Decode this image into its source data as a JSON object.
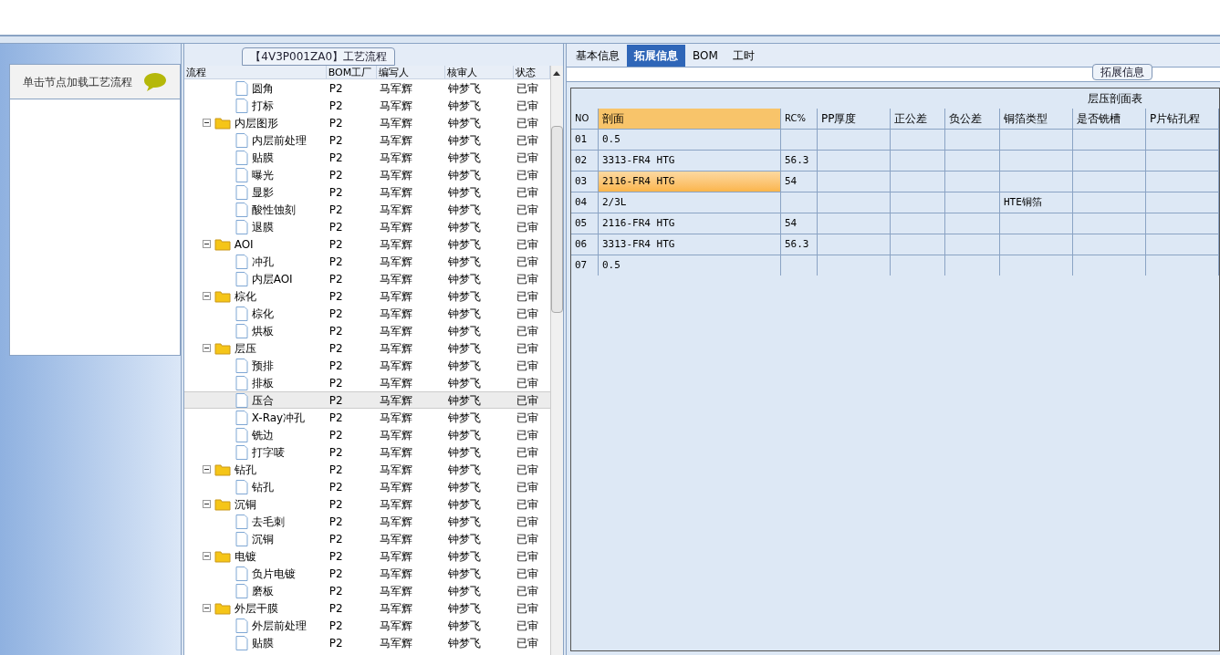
{
  "left_panel": {
    "hint": "单击节点加载工艺流程"
  },
  "flow_panel": {
    "title": "【4V3P001ZA0】工艺流程",
    "columns": [
      "流程",
      "BOM工厂",
      "编写人",
      "核审人",
      "状态"
    ],
    "tree": [
      {
        "kind": "file",
        "label": "圆角",
        "selected": false,
        "cells": [
          "P2",
          "马军辉",
          "钟梦飞",
          "已审"
        ]
      },
      {
        "kind": "file",
        "label": "打标",
        "selected": false,
        "cells": [
          "P2",
          "马军辉",
          "钟梦飞",
          "已审"
        ]
      },
      {
        "kind": "folder",
        "label": "内层图形",
        "expanded": true,
        "selected": false,
        "cells": [
          "P2",
          "马军辉",
          "钟梦飞",
          "已审"
        ],
        "children": [
          {
            "kind": "file",
            "label": "内层前处理",
            "selected": false,
            "cells": [
              "P2",
              "马军辉",
              "钟梦飞",
              "已审"
            ]
          },
          {
            "kind": "file",
            "label": "贴膜",
            "selected": false,
            "cells": [
              "P2",
              "马军辉",
              "钟梦飞",
              "已审"
            ]
          },
          {
            "kind": "file",
            "label": "曝光",
            "selected": false,
            "cells": [
              "P2",
              "马军辉",
              "钟梦飞",
              "已审"
            ]
          },
          {
            "kind": "file",
            "label": "显影",
            "selected": false,
            "cells": [
              "P2",
              "马军辉",
              "钟梦飞",
              "已审"
            ]
          },
          {
            "kind": "file",
            "label": "酸性蚀刻",
            "selected": false,
            "cells": [
              "P2",
              "马军辉",
              "钟梦飞",
              "已审"
            ]
          },
          {
            "kind": "file",
            "label": "退膜",
            "selected": false,
            "cells": [
              "P2",
              "马军辉",
              "钟梦飞",
              "已审"
            ]
          }
        ]
      },
      {
        "kind": "folder",
        "label": "AOI",
        "expanded": true,
        "selected": false,
        "cells": [
          "P2",
          "马军辉",
          "钟梦飞",
          "已审"
        ],
        "children": [
          {
            "kind": "file",
            "label": "冲孔",
            "selected": false,
            "cells": [
              "P2",
              "马军辉",
              "钟梦飞",
              "已审"
            ]
          },
          {
            "kind": "file",
            "label": "内层AOI",
            "selected": false,
            "cells": [
              "P2",
              "马军辉",
              "钟梦飞",
              "已审"
            ]
          }
        ]
      },
      {
        "kind": "folder",
        "label": "棕化",
        "expanded": true,
        "selected": false,
        "cells": [
          "P2",
          "马军辉",
          "钟梦飞",
          "已审"
        ],
        "children": [
          {
            "kind": "file",
            "label": "棕化",
            "selected": false,
            "cells": [
              "P2",
              "马军辉",
              "钟梦飞",
              "已审"
            ]
          },
          {
            "kind": "file",
            "label": "烘板",
            "selected": false,
            "cells": [
              "P2",
              "马军辉",
              "钟梦飞",
              "已审"
            ]
          }
        ]
      },
      {
        "kind": "folder",
        "label": "层压",
        "expanded": true,
        "selected": false,
        "cells": [
          "P2",
          "马军辉",
          "钟梦飞",
          "已审"
        ],
        "children": [
          {
            "kind": "file",
            "label": "预排",
            "selected": false,
            "cells": [
              "P2",
              "马军辉",
              "钟梦飞",
              "已审"
            ]
          },
          {
            "kind": "file",
            "label": "排板",
            "selected": false,
            "cells": [
              "P2",
              "马军辉",
              "钟梦飞",
              "已审"
            ]
          },
          {
            "kind": "file",
            "label": "压合",
            "selected": true,
            "cells": [
              "P2",
              "马军辉",
              "钟梦飞",
              "已审"
            ]
          },
          {
            "kind": "file",
            "label": "X-Ray冲孔",
            "selected": false,
            "cells": [
              "P2",
              "马军辉",
              "钟梦飞",
              "已审"
            ]
          },
          {
            "kind": "file",
            "label": "铣边",
            "selected": false,
            "cells": [
              "P2",
              "马军辉",
              "钟梦飞",
              "已审"
            ]
          },
          {
            "kind": "file",
            "label": "打字唛",
            "selected": false,
            "cells": [
              "P2",
              "马军辉",
              "钟梦飞",
              "已审"
            ]
          }
        ]
      },
      {
        "kind": "folder",
        "label": "钻孔",
        "expanded": true,
        "selected": false,
        "cells": [
          "P2",
          "马军辉",
          "钟梦飞",
          "已审"
        ],
        "children": [
          {
            "kind": "file",
            "label": "钻孔",
            "selected": false,
            "cells": [
              "P2",
              "马军辉",
              "钟梦飞",
              "已审"
            ]
          }
        ]
      },
      {
        "kind": "folder",
        "label": "沉铜",
        "expanded": true,
        "selected": false,
        "cells": [
          "P2",
          "马军辉",
          "钟梦飞",
          "已审"
        ],
        "children": [
          {
            "kind": "file",
            "label": "去毛刺",
            "selected": false,
            "cells": [
              "P2",
              "马军辉",
              "钟梦飞",
              "已审"
            ]
          },
          {
            "kind": "file",
            "label": "沉铜",
            "selected": false,
            "cells": [
              "P2",
              "马军辉",
              "钟梦飞",
              "已审"
            ]
          }
        ]
      },
      {
        "kind": "folder",
        "label": "电镀",
        "expanded": true,
        "selected": false,
        "cells": [
          "P2",
          "马军辉",
          "钟梦飞",
          "已审"
        ],
        "children": [
          {
            "kind": "file",
            "label": "负片电镀",
            "selected": false,
            "cells": [
              "P2",
              "马军辉",
              "钟梦飞",
              "已审"
            ]
          },
          {
            "kind": "file",
            "label": "磨板",
            "selected": false,
            "cells": [
              "P2",
              "马军辉",
              "钟梦飞",
              "已审"
            ]
          }
        ]
      },
      {
        "kind": "folder",
        "label": "外层干膜",
        "expanded": true,
        "selected": false,
        "cells": [
          "P2",
          "马军辉",
          "钟梦飞",
          "已审"
        ],
        "children": [
          {
            "kind": "file",
            "label": "外层前处理",
            "selected": false,
            "cells": [
              "P2",
              "马军辉",
              "钟梦飞",
              "已审"
            ]
          },
          {
            "kind": "file",
            "label": "贴膜",
            "selected": false,
            "cells": [
              "P2",
              "马军辉",
              "钟梦飞",
              "已审"
            ]
          }
        ]
      }
    ]
  },
  "detail_panel": {
    "tabs": [
      {
        "label": "基本信息",
        "selected": false
      },
      {
        "label": "拓展信息",
        "selected": true
      },
      {
        "label": "BOM",
        "selected": false
      },
      {
        "label": "工时",
        "selected": false
      }
    ],
    "group_title": "拓展信息",
    "table": {
      "title": "层压剖面表",
      "columns": [
        {
          "label": "NO",
          "selected": false
        },
        {
          "label": "剖面",
          "selected": true
        },
        {
          "label": "RC%",
          "selected": false
        },
        {
          "label": "PP厚度",
          "selected": false
        },
        {
          "label": "正公差",
          "selected": false
        },
        {
          "label": "负公差",
          "selected": false
        },
        {
          "label": "铜箔类型",
          "selected": false
        },
        {
          "label": "是否铣槽",
          "selected": false
        },
        {
          "label": "P片钻孔程",
          "selected": false
        }
      ],
      "rows": [
        {
          "selected": false,
          "cells": [
            "01",
            "0.5",
            "",
            "",
            "",
            "",
            "",
            "",
            ""
          ]
        },
        {
          "selected": false,
          "cells": [
            "02",
            "3313-FR4 HTG",
            "56.3",
            "",
            "",
            "",
            "",
            "",
            ""
          ]
        },
        {
          "selected": true,
          "cells": [
            "03",
            "2116-FR4 HTG",
            "54",
            "",
            "",
            "",
            "",
            "",
            ""
          ]
        },
        {
          "selected": false,
          "cells": [
            "04",
            "2/3L",
            "",
            "",
            "",
            "",
            "HTE铜箔",
            "",
            ""
          ]
        },
        {
          "selected": false,
          "cells": [
            "05",
            "2116-FR4 HTG",
            "54",
            "",
            "",
            "",
            "",
            "",
            ""
          ]
        },
        {
          "selected": false,
          "cells": [
            "06",
            "3313-FR4 HTG",
            "56.3",
            "",
            "",
            "",
            "",
            "",
            ""
          ]
        },
        {
          "selected": false,
          "cells": [
            "07",
            "0.5",
            "",
            "",
            "",
            "",
            "",
            "",
            ""
          ]
        }
      ]
    }
  }
}
